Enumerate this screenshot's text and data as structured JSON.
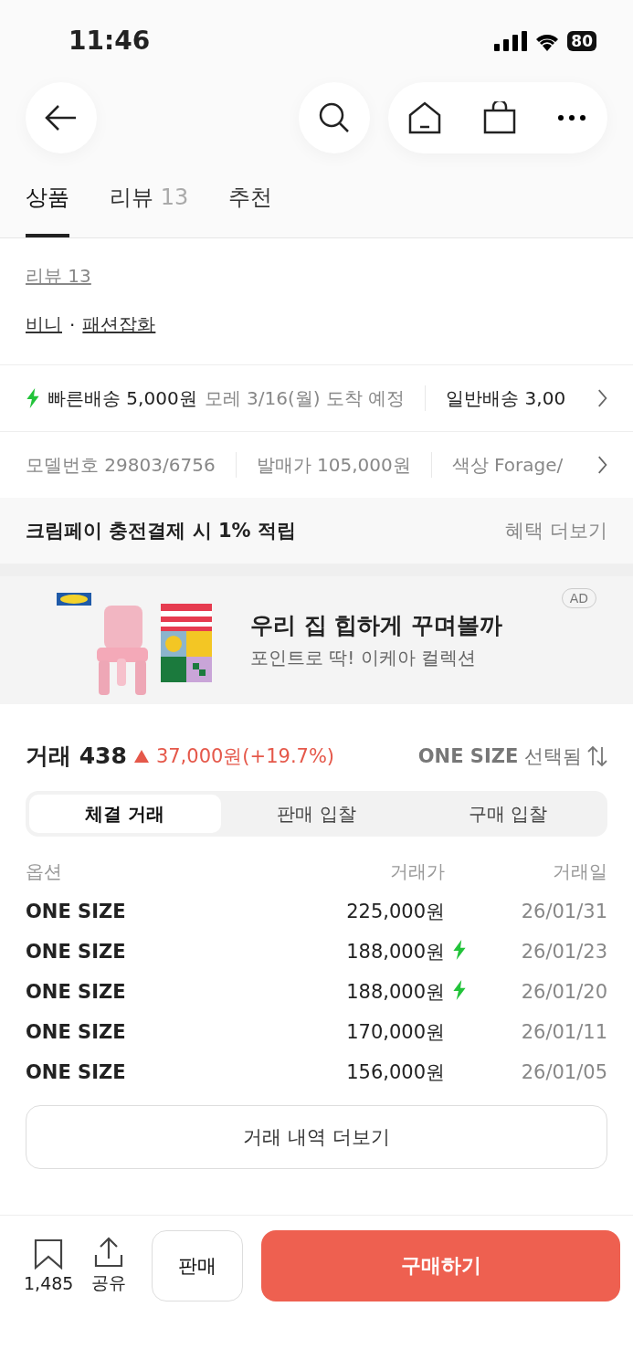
{
  "status_bar": {
    "time": "11:46",
    "battery": "80"
  },
  "tabs": [
    {
      "label": "상품",
      "selected": true
    },
    {
      "label": "리뷰",
      "count": "13",
      "selected": false
    },
    {
      "label": "추천",
      "selected": false
    }
  ],
  "review_link": "리뷰 13",
  "categories": {
    "items": [
      "비니",
      "패션잡화"
    ],
    "separator": "·"
  },
  "delivery": [
    {
      "kind": "fast",
      "label": "빠른배송 5,000원",
      "note": "모레 3/16(월) 도착 예정"
    },
    {
      "kind": "normal",
      "label": "일반배송 3,00"
    }
  ],
  "specs": [
    "모델번호 29803/6756",
    "발매가 105,000원",
    "색상 Forage/"
  ],
  "benefit": {
    "text": "크림페이 충전결제 시 1% 적립",
    "link": "혜택 더보기"
  },
  "ad": {
    "kind": "picture",
    "title": "우리 집 힙하게 꾸며볼까",
    "subtitle": "포인트로 딱! 이케아 컬렉션",
    "badge": "AD"
  },
  "trades": {
    "title": "거래 438",
    "change": "37,000원(+19.7%)",
    "size": "**ONE SIZE** 선택됨",
    "tabs": [
      {
        "label": "체결 거래",
        "selected": true
      },
      {
        "label": "판매 입찰",
        "selected": false
      },
      {
        "label": "구매 입찰",
        "selected": false
      }
    ],
    "columns": [
      "옵션",
      "거래가",
      "거래일"
    ],
    "rows": [
      {
        "option": "ONE SIZE",
        "price": "225,000원",
        "fast": false,
        "date": "26/01/31"
      },
      {
        "option": "ONE SIZE",
        "price": "188,000원",
        "fast": true,
        "date": "26/01/23"
      },
      {
        "option": "ONE SIZE",
        "price": "188,000원",
        "fast": true,
        "date": "26/01/20"
      },
      {
        "option": "ONE SIZE",
        "price": "170,000원",
        "fast": false,
        "date": "26/01/11"
      },
      {
        "option": "ONE SIZE",
        "price": "156,000원",
        "fast": false,
        "date": "26/01/05"
      }
    ],
    "more_button": "거래 내역 더보기"
  },
  "bottom_bar": {
    "bookmark_count": "1,485",
    "share": "공유",
    "sell": "판매",
    "buy": "구매하기"
  }
}
